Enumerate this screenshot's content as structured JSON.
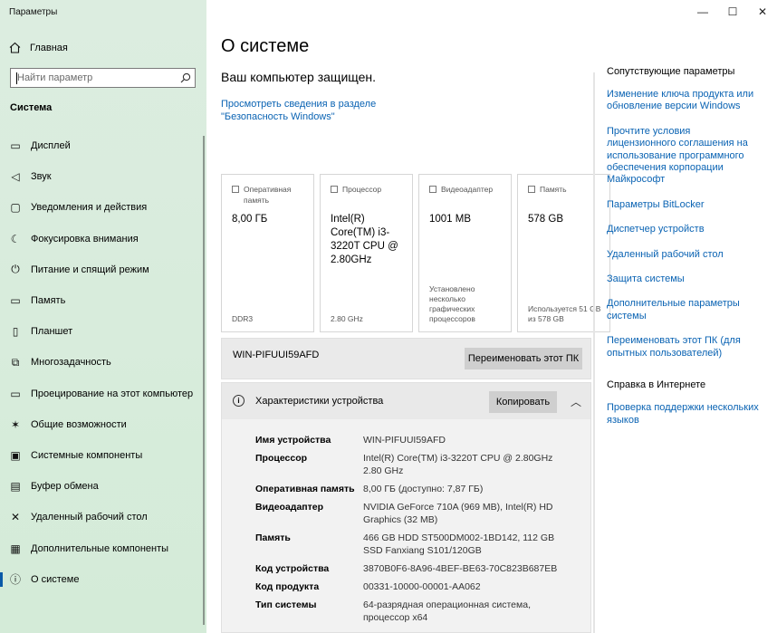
{
  "window": {
    "title": "Параметры",
    "minimize": "—",
    "maximize": "☐",
    "close": "✕"
  },
  "sidebar": {
    "home_label": "Главная",
    "search_placeholder": "Найти параметр",
    "section_title": "Система",
    "items": [
      {
        "label": "Дисплей",
        "icon": "display-icon",
        "glyph": "▭"
      },
      {
        "label": "Звук",
        "icon": "speaker-icon",
        "glyph": "◁"
      },
      {
        "label": "Уведомления и действия",
        "icon": "notifications-icon",
        "glyph": "▢"
      },
      {
        "label": "Фокусировка внимания",
        "icon": "moon-icon",
        "glyph": "☾"
      },
      {
        "label": "Питание и спящий режим",
        "icon": "power-icon",
        "glyph": "⏻"
      },
      {
        "label": "Память",
        "icon": "storage-icon",
        "glyph": "▭"
      },
      {
        "label": "Планшет",
        "icon": "tablet-icon",
        "glyph": "▯"
      },
      {
        "label": "Многозадачность",
        "icon": "multitask-icon",
        "glyph": "⧉"
      },
      {
        "label": "Проецирование на этот компьютер",
        "icon": "project-icon",
        "glyph": "▭"
      },
      {
        "label": "Общие возможности",
        "icon": "shared-icon",
        "glyph": "✶"
      },
      {
        "label": "Системные компоненты",
        "icon": "components-icon",
        "glyph": "▣"
      },
      {
        "label": "Буфер обмена",
        "icon": "clipboard-icon",
        "glyph": "▤"
      },
      {
        "label": "Удаленный рабочий стол",
        "icon": "remote-icon",
        "glyph": "✕"
      },
      {
        "label": "Дополнительные компоненты",
        "icon": "optional-icon",
        "glyph": "▦"
      },
      {
        "label": "О системе",
        "icon": "info-icon",
        "glyph": "ⓘ",
        "active": true
      }
    ]
  },
  "main": {
    "title": "О системе",
    "protected": "Ваш компьютер защищен.",
    "security_link": "Просмотреть сведения в разделе \"Безопасность Windows\"",
    "cards": [
      {
        "head": "Оперативная память",
        "value": "8,00 ГБ",
        "sub": "DDR3"
      },
      {
        "head": "Процессор",
        "value": "Intel(R) Core(TM) i3-3220T CPU @ 2.80GHz",
        "sub": "2.80 GHz"
      },
      {
        "head": "Видеоадаптер",
        "value": "1001 MB",
        "sub": "Установлено несколько графических процессоров"
      },
      {
        "head": "Память",
        "value": "578 GB",
        "sub": "Используется 51 GB из 578 GB"
      }
    ],
    "pc_name": "WIN-PIFUUI59AFD",
    "rename_button": "Переименовать этот ПК",
    "spec_title": "Характеристики устройства",
    "copy_button": "Копировать",
    "specs": [
      {
        "k": "Имя устройства",
        "v": "WIN-PIFUUI59AFD"
      },
      {
        "k": "Процессор",
        "v": "Intel(R) Core(TM) i3-3220T CPU @ 2.80GHz 2.80 GHz"
      },
      {
        "k": "Оперативная память",
        "v": "8,00 ГБ (доступно: 7,87 ГБ)"
      },
      {
        "k": "Видеоадаптер",
        "v": "NVIDIA GeForce 710A (969 MB), Intel(R) HD Graphics (32 MB)"
      },
      {
        "k": "Память",
        "v": "466 GB HDD ST500DM002-1BD142, 112 GB SSD Fanxiang S101/120GB"
      },
      {
        "k": "Код устройства",
        "v": "3870B0F6-8A96-4BEF-BE63-70C823B687EB"
      },
      {
        "k": "Код продукта",
        "v": "00331-10000-00001-AA062"
      },
      {
        "k": "Тип системы",
        "v": "64-разрядная операционная система, процессор x64"
      }
    ]
  },
  "related": {
    "title": "Сопутствующие параметры",
    "links": [
      "Изменение ключа продукта или обновление версии Windows",
      "Прочтите условия лицензионного соглашения на использование программного обеспечения корпорации Майкрософт",
      "Параметры BitLocker",
      "Диспетчер устройств",
      "Удаленный рабочий стол",
      "Защита системы",
      "Дополнительные параметры системы",
      "Переименовать этот ПК (для опытных пользователей)"
    ],
    "help_title": "Справка в Интернете",
    "help_links": [
      "Проверка поддержки нескольких языков"
    ]
  }
}
